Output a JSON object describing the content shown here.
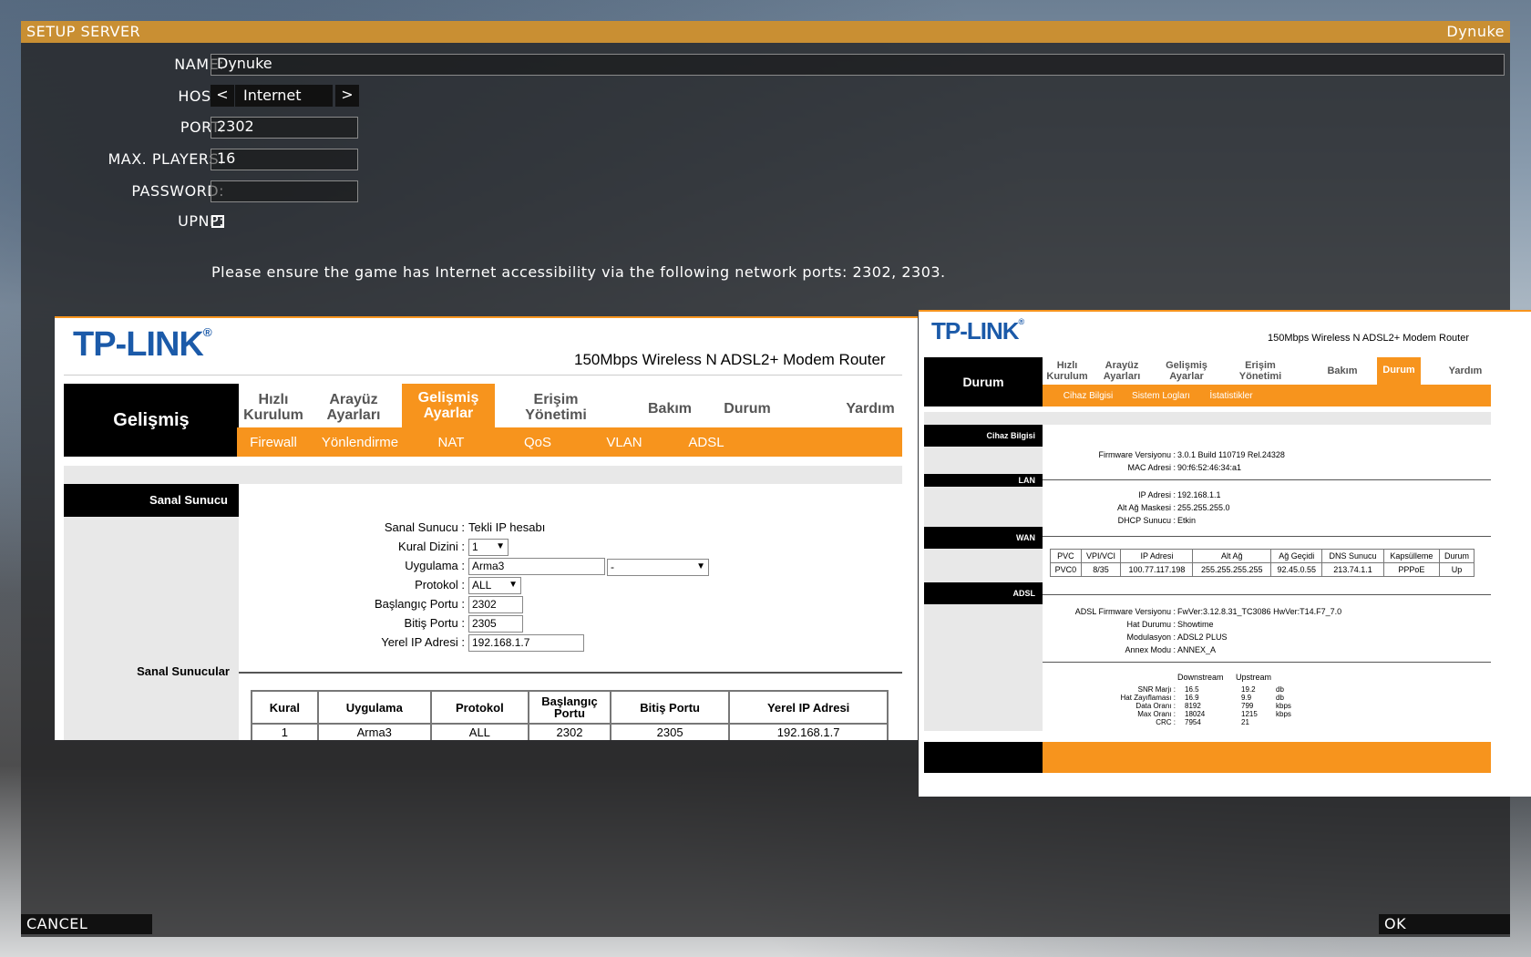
{
  "dialog": {
    "title": "SETUP SERVER",
    "profile_name": "Dynuke"
  },
  "form": {
    "name_label": "NAME:",
    "name_value": "Dynuke",
    "host_label": "HOST:",
    "host_prev": "<",
    "host_value": "Internet",
    "host_next": ">",
    "port_label": "PORT:",
    "port_value": "2302",
    "maxplayers_label": "MAX. PLAYERS:",
    "maxplayers_value": "16",
    "password_label": "PASSWORD:",
    "password_value": "",
    "upnp_label": "UPNP:",
    "upnp_checked": false
  },
  "notice": "Please ensure the game has Internet accessibility via the following network ports: 2302, 2303.",
  "buttons": {
    "cancel": "CANCEL",
    "ok": "OK"
  },
  "router1": {
    "logo": "TP-LINK",
    "model": "150Mbps Wireless N ADSL2+ Modem Router",
    "section": "Gelişmiş",
    "nav": [
      {
        "l1": "Hızlı",
        "l2": "Kurulum"
      },
      {
        "l1": "Arayüz",
        "l2": "Ayarları"
      },
      {
        "l1": "Gelişmiş",
        "l2": "Ayarlar"
      },
      {
        "l1": "Erişim",
        "l2": "Yönetimi"
      },
      {
        "l1": "Bakım",
        "l2": ""
      },
      {
        "l1": "Durum",
        "l2": ""
      },
      {
        "l1": "Yardım",
        "l2": ""
      }
    ],
    "subnav": [
      "Firewall",
      "Yönlendirme",
      "NAT",
      "QoS",
      "VLAN",
      "ADSL"
    ],
    "side1": "Sanal Sunucu",
    "side2": "Sanal Sunucular",
    "form": {
      "vs_label": "Sanal Sunucu :",
      "vs_value": "Tekli IP hesabı",
      "rule_label": "Kural Dizini :",
      "rule_value": "1",
      "app_label": "Uygulama :",
      "app_value": "Arma3",
      "app_select": "-",
      "proto_label": "Protokol :",
      "proto_value": "ALL",
      "start_label": "Başlangıç Portu :",
      "start_value": "2302",
      "end_label": "Bitiş Portu :",
      "end_value": "2305",
      "ip_label": "Yerel IP Adresi :",
      "ip_value": "192.168.1.7"
    },
    "table": {
      "headers": [
        "Kural",
        "Uygulama",
        "Protokol",
        "Başlangıç Portu",
        "Bitiş Portu",
        "Yerel IP Adresi"
      ],
      "rows": [
        [
          "1",
          "Arma3",
          "ALL",
          "2302",
          "2305",
          "192.168.1.7"
        ]
      ]
    }
  },
  "router2": {
    "logo": "TP-LINK",
    "model": "150Mbps Wireless N ADSL2+ Modem Router",
    "section": "Durum",
    "nav": [
      {
        "l1": "Hızlı",
        "l2": "Kurulum"
      },
      {
        "l1": "Arayüz",
        "l2": "Ayarları"
      },
      {
        "l1": "Gelişmiş",
        "l2": "Ayarlar"
      },
      {
        "l1": "Erişim",
        "l2": "Yönetimi"
      },
      {
        "l1": "Bakım",
        "l2": ""
      },
      {
        "l1": "Durum",
        "l2": ""
      },
      {
        "l1": "Yardım",
        "l2": ""
      }
    ],
    "subnav": [
      "Cihaz Bilgisi",
      "Sistem Logları",
      "İstatistikler"
    ],
    "sides": [
      "Cihaz Bilgisi",
      "LAN",
      "WAN",
      "ADSL"
    ],
    "device": {
      "fw_label": "Firmware Versiyonu :",
      "fw_value": "3.0.1 Build 110719 Rel.24328",
      "mac_label": "MAC Adresi :",
      "mac_value": "90:f6:52:46:34:a1"
    },
    "lan": {
      "ip_label": "IP Adresi :",
      "ip_value": "192.168.1.1",
      "mask_label": "Alt Ağ Maskesi :",
      "mask_value": "255.255.255.0",
      "dhcp_label": "DHCP Sunucu :",
      "dhcp_value": "Etkin"
    },
    "wan": {
      "headers": [
        "PVC",
        "VPI/VCI",
        "IP Adresi",
        "Alt Ağ",
        "Ağ Geçidi",
        "DNS Sunucu",
        "Kapsülleme",
        "Durum"
      ],
      "row": [
        "PVC0",
        "8/35",
        "100.77.117.198",
        "255.255.255.255",
        "92.45.0.55",
        "213.74.1.1",
        "PPPoE",
        "Up"
      ]
    },
    "adsl": {
      "fw_label": "ADSL Firmware Versiyonu :",
      "fw_value": "FwVer:3.12.8.31_TC3086 HwVer:T14.F7_7.0",
      "line_label": "Hat Durumu :",
      "line_value": "Showtime",
      "mod_label": "Modulasyon :",
      "mod_value": "ADSL2 PLUS",
      "annex_label": "Annex Modu :",
      "annex_value": "ANNEX_A"
    },
    "stats": {
      "col1": "Downstream",
      "col2": "Upstream",
      "rows": [
        [
          "SNR Marjı :",
          "16.5",
          "19.2",
          "db"
        ],
        [
          "Hat Zayıflaması :",
          "16.9",
          "9.9",
          "db"
        ],
        [
          "Data Oranı :",
          "8192",
          "799",
          "kbps"
        ],
        [
          "Max Oranı :",
          "18024",
          "1215",
          "kbps"
        ],
        [
          "CRC :",
          "7954",
          "21",
          ""
        ]
      ]
    }
  }
}
